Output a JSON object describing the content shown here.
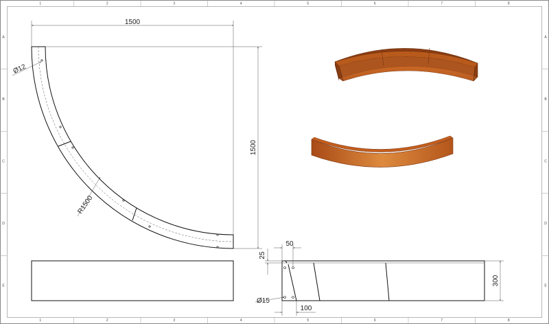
{
  "drawing": {
    "border_columns": [
      "1",
      "2",
      "3",
      "4",
      "5",
      "6",
      "7",
      "8"
    ],
    "border_rows": [
      "A",
      "B",
      "C",
      "D",
      "E"
    ]
  },
  "dimensions": {
    "width": "1500",
    "height": "1500",
    "radius": "R1500",
    "hole_top": "Ø12",
    "side_top": "25",
    "side_offset": "50",
    "side_height": "300",
    "side_bottom": "100",
    "hole_side": "Ø15"
  },
  "colors": {
    "steel_light": "#d4722a",
    "steel_dark": "#a94b14",
    "steel_edge": "#7a3510"
  }
}
